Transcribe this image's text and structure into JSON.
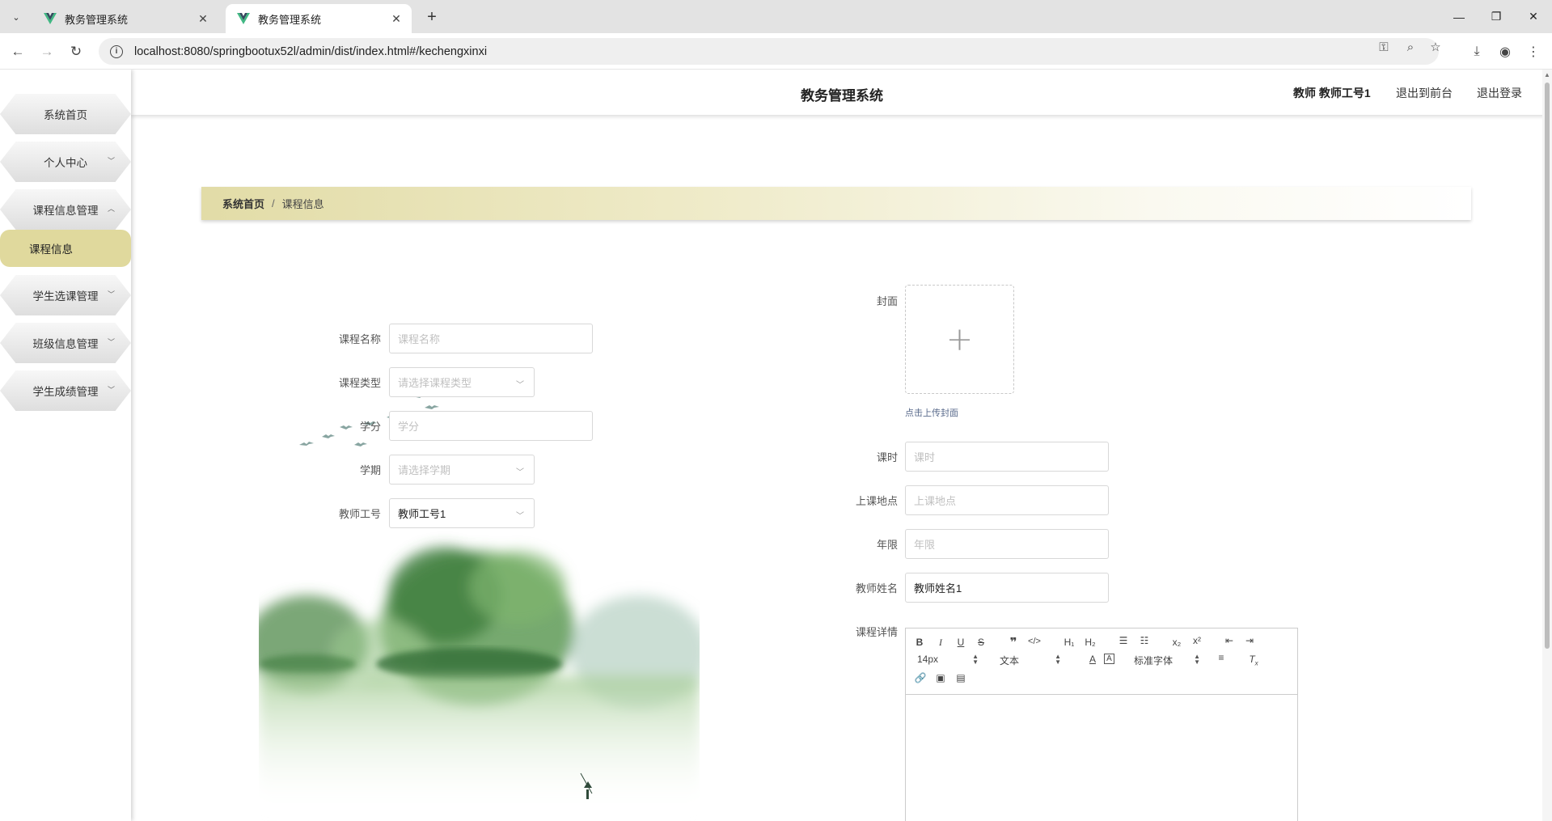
{
  "browser": {
    "tabs": [
      {
        "title": "教务管理系统",
        "active": false
      },
      {
        "title": "教务管理系统",
        "active": true
      }
    ],
    "url": "localhost:8080/springbootux52l/admin/dist/index.html#/kechengxinxi"
  },
  "header": {
    "title": "教务管理系统",
    "user": "教师 教师工号1",
    "back_link": "退出到前台",
    "logout_link": "退出登录"
  },
  "sidebar": {
    "items": [
      {
        "label": "系统首页",
        "has_arrow": false
      },
      {
        "label": "个人中心",
        "has_arrow": true,
        "arrow": "down"
      },
      {
        "label": "课程信息管理",
        "has_arrow": true,
        "arrow": "up"
      },
      {
        "label": "学生选课管理",
        "has_arrow": true,
        "arrow": "down"
      },
      {
        "label": "班级信息管理",
        "has_arrow": true,
        "arrow": "down"
      },
      {
        "label": "学生成绩管理",
        "has_arrow": true,
        "arrow": "down"
      }
    ],
    "active_sub": "课程信息"
  },
  "breadcrumb": {
    "home": "系统首页",
    "sep": "/",
    "current": "课程信息"
  },
  "form": {
    "course_name": {
      "label": "课程名称",
      "placeholder": "课程名称"
    },
    "course_type": {
      "label": "课程类型",
      "placeholder": "请选择课程类型"
    },
    "credit": {
      "label": "学分",
      "placeholder": "学分"
    },
    "semester": {
      "label": "学期",
      "placeholder": "请选择学期"
    },
    "teacher_id": {
      "label": "教师工号",
      "value": "教师工号1"
    },
    "cover": {
      "label": "封面",
      "tip": "点击上传封面"
    },
    "hours": {
      "label": "课时",
      "placeholder": "课时"
    },
    "location": {
      "label": "上课地点",
      "placeholder": "上课地点"
    },
    "years": {
      "label": "年限",
      "placeholder": "年限"
    },
    "teacher_name": {
      "label": "教师姓名",
      "value": "教师姓名1"
    },
    "detail": {
      "label": "课程详情"
    }
  },
  "editor": {
    "font_size": "14px",
    "text_style": "文本",
    "font_family": "标准字体",
    "tools": [
      "bold-icon",
      "italic-icon",
      "underline-icon",
      "strikethrough-icon",
      "quote-icon",
      "code-icon",
      "h1-icon",
      "h2-icon",
      "ordered-list-icon",
      "bullet-list-icon",
      "subscript-icon",
      "superscript-icon",
      "outdent-icon",
      "indent-icon",
      "font-color-icon",
      "background-color-icon",
      "align-icon",
      "clear-format-icon",
      "link-icon",
      "image-icon",
      "video-icon"
    ]
  },
  "colors": {
    "accent": "#e0d99d",
    "breadcrumb_start": "#e2dca7"
  }
}
